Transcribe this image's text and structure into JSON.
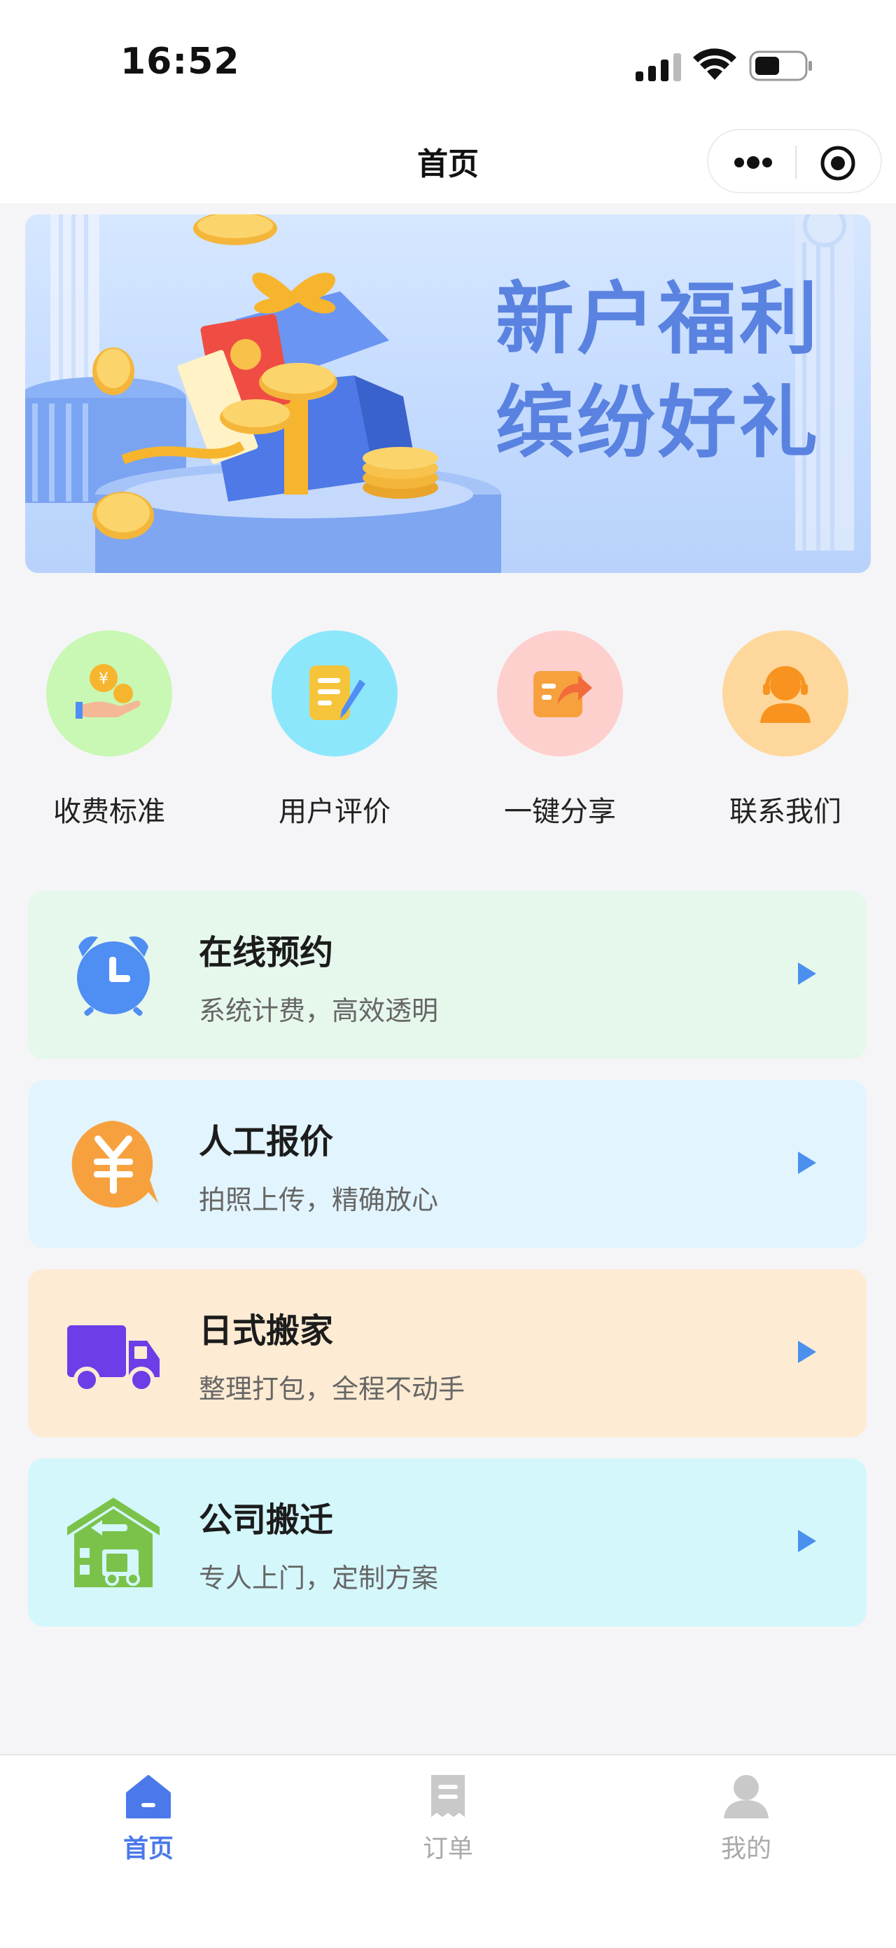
{
  "status_bar": {
    "time": "16:52"
  },
  "nav": {
    "title": "首页"
  },
  "banner": {
    "line1": "新户福利",
    "line2": "缤纷好礼"
  },
  "quick_actions": [
    {
      "label": "收费标准",
      "icon": "money-hand-icon",
      "bg": "#c9f7b4"
    },
    {
      "label": "用户评价",
      "icon": "edit-note-icon",
      "bg": "#8de7fb"
    },
    {
      "label": "一键分享",
      "icon": "share-icon",
      "bg": "#fdd0ce"
    },
    {
      "label": "联系我们",
      "icon": "customer-service-icon",
      "bg": "#fed79c"
    }
  ],
  "services": [
    {
      "title": "在线预约",
      "subtitle": "系统计费，高效透明",
      "icon": "alarm-clock-icon",
      "bg": "#e6f7ec"
    },
    {
      "title": "人工报价",
      "subtitle": "拍照上传，精确放心",
      "icon": "yuan-bubble-icon",
      "bg": "#e2f4fd"
    },
    {
      "title": "日式搬家",
      "subtitle": "整理打包，全程不动手",
      "icon": "truck-icon",
      "bg": "#fdebd3"
    },
    {
      "title": "公司搬迁",
      "subtitle": "专人上门，定制方案",
      "icon": "warehouse-icon",
      "bg": "#d4f7fb"
    }
  ],
  "tabs": [
    {
      "label": "首页",
      "icon": "home-icon",
      "active": true
    },
    {
      "label": "订单",
      "icon": "order-icon",
      "active": false
    },
    {
      "label": "我的",
      "icon": "user-icon",
      "active": false
    }
  ],
  "colors": {
    "accent": "#4b79ea",
    "arrow": "#4a90ef"
  }
}
